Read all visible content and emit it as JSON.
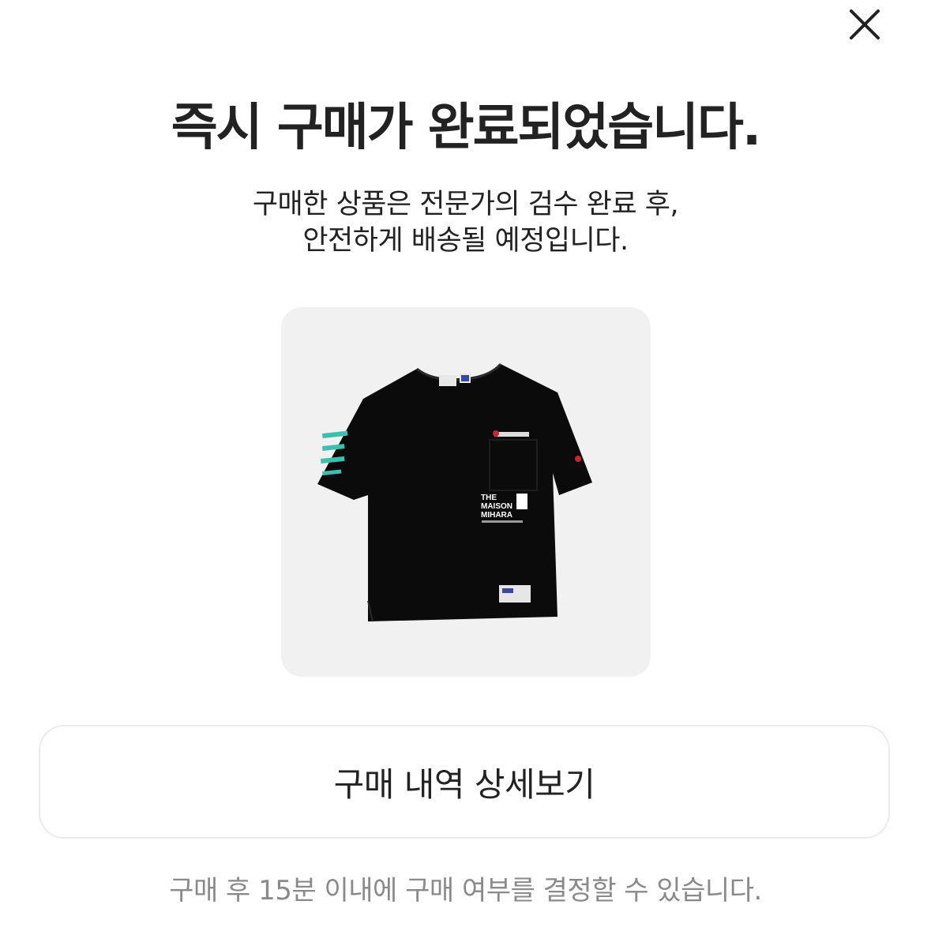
{
  "close_icon": "close-icon",
  "title": "즉시 구매가 완료되었습니다.",
  "subtitle": {
    "line1": "구매한 상품은 전문가의 검수 완료 후,",
    "line2": "안전하게 배송될 예정입니다."
  },
  "product": {
    "image": "black-tshirt-image",
    "print_lines": [
      "THE",
      "MAISON",
      "MIHARA"
    ]
  },
  "detail_button_label": "구매 내역 상세보기",
  "notice": "구매 후 15분 이내에 구매 여부를 결정할 수 있습니다.",
  "colors": {
    "background": "#ffffff",
    "text": "#222222",
    "muted": "#8a8a8a",
    "card": "#f1f1f1",
    "border": "#ebebeb"
  }
}
